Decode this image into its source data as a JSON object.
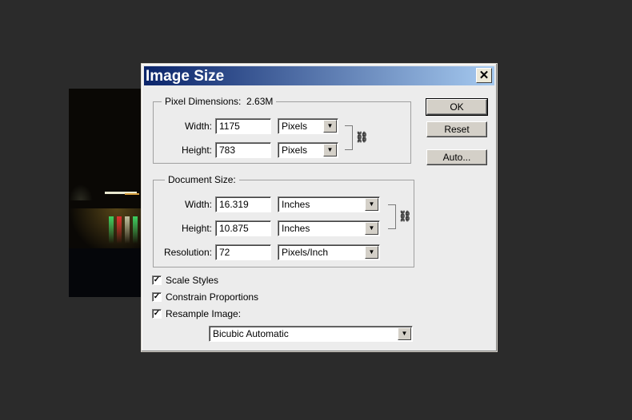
{
  "dialog": {
    "title": "Image Size",
    "close_glyph": "✕"
  },
  "pixel_dimensions": {
    "legend": "Pixel Dimensions:",
    "size": "2.63M",
    "width_label": "Width:",
    "width_value": "1175",
    "width_unit": "Pixels",
    "height_label": "Height:",
    "height_value": "783",
    "height_unit": "Pixels",
    "link_icon": "chain-link-icon"
  },
  "document_size": {
    "legend": "Document Size:",
    "width_label": "Width:",
    "width_value": "16.319",
    "width_unit": "Inches",
    "height_label": "Height:",
    "height_value": "10.875",
    "height_unit": "Inches",
    "resolution_label": "Resolution:",
    "resolution_value": "72",
    "resolution_unit": "Pixels/Inch",
    "link_icon": "chain-link-icon"
  },
  "buttons": {
    "ok": "OK",
    "reset": "Reset",
    "auto": "Auto..."
  },
  "options": {
    "scale_styles": {
      "label": "Scale Styles",
      "checked": true
    },
    "constrain_proportions": {
      "label": "Constrain Proportions",
      "checked": true
    },
    "resample_image": {
      "label": "Resample Image:",
      "checked": true
    },
    "resample_method": "Bicubic Automatic",
    "check_glyph": "✓"
  },
  "colors": {
    "titlebar_start": "#0a246a",
    "titlebar_end": "#a6caf0",
    "workspace": "#2b2b2b"
  }
}
